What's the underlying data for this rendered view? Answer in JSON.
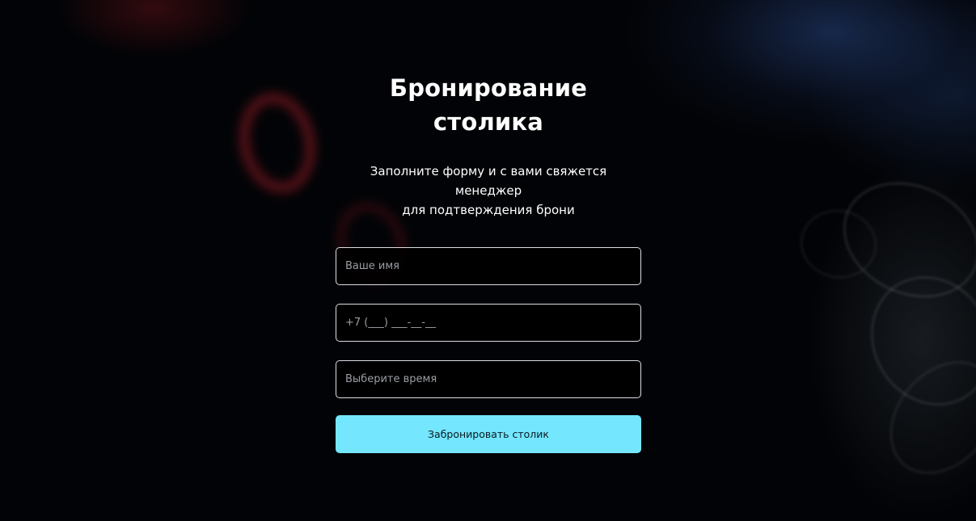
{
  "booking": {
    "title": "Бронирование столика",
    "subtitle_line1": "Заполните форму и с вами свяжется менеджер",
    "subtitle_line2": "для подтверждения брони",
    "name_field": {
      "placeholder": "Ваше имя",
      "value": ""
    },
    "phone_field": {
      "placeholder": "+7 (___) ___-__-__",
      "value": ""
    },
    "time_field": {
      "placeholder": "Выберите время",
      "value": ""
    },
    "submit_label": "Забронировать столик"
  },
  "colors": {
    "background": "#020306",
    "accent_button": "#74e7ff",
    "field_border": "#d9dde2",
    "text_primary": "#ffffff",
    "placeholder": "#9a9ea4"
  }
}
